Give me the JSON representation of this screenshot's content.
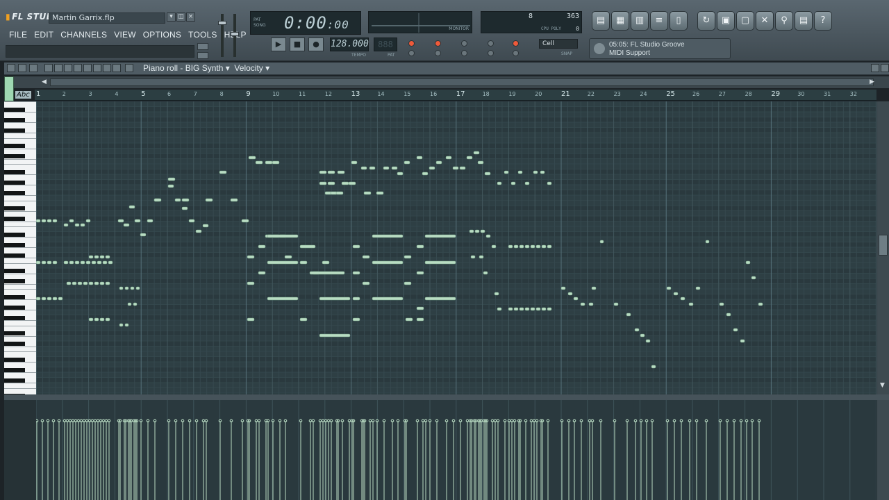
{
  "app": {
    "logo": "FL STUDIO",
    "project_title": "Martin Garrix.flp"
  },
  "menu": [
    "FILE",
    "EDIT",
    "CHANNELS",
    "VIEW",
    "OPTIONS",
    "TOOLS",
    "HELP"
  ],
  "transport": {
    "time": "0:00",
    "time_sub": ":00",
    "pat_label": "PAT",
    "song_label": "SONG",
    "tempo": "128.000",
    "tempo_label": "TEMPO",
    "pat_value": "888",
    "pat_caption": "PAT"
  },
  "monitor": {
    "label": "MONITOR"
  },
  "cpu": {
    "poly": "8",
    "ram": "363",
    "label_ram": "RAM",
    "label_cpu": "CPU",
    "label_poly": "POLY",
    "zero": "0"
  },
  "snap": {
    "value": "Cell",
    "label": "SNAP"
  },
  "news": {
    "line1": "05:05: FL Studio Groove",
    "line2": "MIDI Support"
  },
  "piano_roll": {
    "title": "Piano roll - BIG Synth",
    "mode": "Velocity",
    "abc": "Abc",
    "bars": [
      "1",
      "2",
      "3",
      "4",
      "5",
      "6",
      "7",
      "8",
      "9",
      "10",
      "11",
      "12",
      "13",
      "14",
      "15",
      "16",
      "17",
      "18",
      "19",
      "20",
      "21",
      "22",
      "23",
      "24",
      "25",
      "26",
      "27",
      "28",
      "29",
      "30",
      "31",
      "32"
    ]
  },
  "colors": {
    "note": "#b9dcc3",
    "grid_bg": "#2e3f44",
    "grid_line": "#3b4f55",
    "bar_line": "#4a6168",
    "accent_led": "#ee5a3a"
  }
}
